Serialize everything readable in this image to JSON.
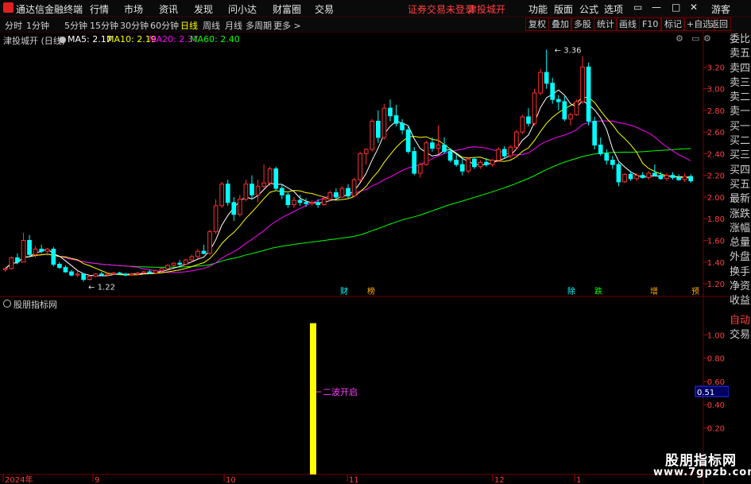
{
  "app": {
    "title": "通达信金融终端",
    "menu": [
      "行情",
      "市场",
      "资讯",
      "发现",
      "问小达",
      "财富圈",
      "交易"
    ],
    "notice": [
      "证券交易未登录",
      "津投城开"
    ],
    "right_menu": [
      "功能",
      "版面",
      "公式",
      "选项"
    ],
    "guest": "游客"
  },
  "toolbar": {
    "periods": [
      "分时",
      "1分钟",
      "5分钟",
      "15分钟",
      "30分钟",
      "60分钟",
      "日线",
      "周线",
      "月线",
      "多周期",
      "更多 >"
    ],
    "active": "日线",
    "right_buttons": [
      "复权",
      "叠加",
      "多股",
      "统计",
      "画线",
      "F10",
      "标记",
      "+自选",
      "返回"
    ]
  },
  "info": {
    "stock": "津投城开 (日线)",
    "ma5": "MA5: 2.17",
    "ma10": "MA10: 2.19",
    "ma20": "MA20: 2.37",
    "ma60": "MA60: 2.40",
    "colors": {
      "ma5": "#ffffff",
      "ma10": "#ffff00",
      "ma20": "#ff00ff",
      "ma60": "#00ff00"
    }
  },
  "side_panel": {
    "items": [
      "委比",
      "卖五",
      "卖四",
      "卖三",
      "卖二",
      "卖一",
      "买一",
      "买二",
      "买三",
      "买四",
      "买五",
      "最新",
      "涨跌",
      "涨幅",
      "总量",
      "外盘",
      "换手",
      "净资",
      "收益"
    ],
    "bottom": [
      "自动",
      "交易"
    ]
  },
  "indicator": {
    "title": "股朋指标网",
    "signal_label": "二波开启",
    "current_value": "0.51"
  },
  "watermark": {
    "line1": "股朋指标网",
    "line2": "www.7gpzb.com"
  },
  "chart_data": [
    {
      "type": "candlestick",
      "y_ticks": [
        "3.20",
        "3.00",
        "2.80",
        "2.60",
        "2.40",
        "2.20",
        "2.00",
        "1.80",
        "1.60",
        "1.40",
        "1.20"
      ],
      "ylim": [
        1.12,
        3.4
      ],
      "x_labels": [
        "2024年",
        "9",
        "10",
        "11",
        "12",
        "1"
      ],
      "annotations": {
        "high": "3.36",
        "low": "1.22"
      },
      "event_markers": [
        "财",
        "榜",
        "除",
        "跌",
        "增",
        "预"
      ],
      "candles": [
        [
          1.33,
          1.35,
          1.31,
          1.34
        ],
        [
          1.34,
          1.45,
          1.33,
          1.44
        ],
        [
          1.44,
          1.48,
          1.38,
          1.4
        ],
        [
          1.4,
          1.67,
          1.4,
          1.6
        ],
        [
          1.6,
          1.65,
          1.45,
          1.47
        ],
        [
          1.47,
          1.55,
          1.44,
          1.52
        ],
        [
          1.52,
          1.56,
          1.48,
          1.5
        ],
        [
          1.5,
          1.53,
          1.46,
          1.52
        ],
        [
          1.52,
          1.54,
          1.36,
          1.38
        ],
        [
          1.38,
          1.4,
          1.34,
          1.35
        ],
        [
          1.35,
          1.37,
          1.3,
          1.31
        ],
        [
          1.31,
          1.33,
          1.27,
          1.28
        ],
        [
          1.28,
          1.32,
          1.26,
          1.29
        ],
        [
          1.29,
          1.3,
          1.22,
          1.24
        ],
        [
          1.24,
          1.28,
          1.23,
          1.27
        ],
        [
          1.27,
          1.3,
          1.26,
          1.29
        ],
        [
          1.29,
          1.31,
          1.27,
          1.28
        ],
        [
          1.28,
          1.3,
          1.27,
          1.29
        ],
        [
          1.29,
          1.31,
          1.28,
          1.3
        ],
        [
          1.3,
          1.31,
          1.28,
          1.29
        ],
        [
          1.29,
          1.3,
          1.27,
          1.28
        ],
        [
          1.28,
          1.3,
          1.27,
          1.29
        ],
        [
          1.29,
          1.31,
          1.28,
          1.3
        ],
        [
          1.3,
          1.32,
          1.29,
          1.31
        ],
        [
          1.31,
          1.33,
          1.29,
          1.3
        ],
        [
          1.3,
          1.33,
          1.29,
          1.32
        ],
        [
          1.32,
          1.35,
          1.31,
          1.34
        ],
        [
          1.34,
          1.38,
          1.33,
          1.37
        ],
        [
          1.37,
          1.4,
          1.35,
          1.39
        ],
        [
          1.39,
          1.42,
          1.36,
          1.38
        ],
        [
          1.38,
          1.43,
          1.37,
          1.42
        ],
        [
          1.42,
          1.47,
          1.4,
          1.45
        ],
        [
          1.45,
          1.52,
          1.43,
          1.5
        ],
        [
          1.5,
          1.56,
          1.47,
          1.48
        ],
        [
          1.48,
          1.7,
          1.47,
          1.68
        ],
        [
          1.68,
          1.98,
          1.66,
          1.92
        ],
        [
          1.92,
          2.14,
          1.9,
          2.12
        ],
        [
          2.12,
          2.16,
          1.92,
          1.95
        ],
        [
          1.95,
          2.0,
          1.78,
          1.84
        ],
        [
          1.84,
          2.02,
          1.82,
          1.98
        ],
        [
          1.98,
          2.16,
          1.96,
          2.12
        ],
        [
          2.12,
          2.2,
          1.98,
          2.02
        ],
        [
          2.02,
          2.16,
          1.95,
          2.1
        ],
        [
          2.1,
          2.3,
          2.08,
          2.13
        ],
        [
          2.13,
          2.28,
          2.1,
          2.26
        ],
        [
          2.26,
          2.28,
          2.06,
          2.08
        ],
        [
          2.08,
          2.12,
          1.98,
          2.02
        ],
        [
          2.02,
          2.04,
          1.9,
          1.93
        ],
        [
          1.93,
          2.0,
          1.9,
          1.97
        ],
        [
          1.97,
          2.02,
          1.92,
          1.95
        ],
        [
          1.95,
          1.99,
          1.91,
          1.94
        ],
        [
          1.94,
          1.97,
          1.92,
          1.95
        ],
        [
          1.95,
          1.98,
          1.9,
          1.93
        ],
        [
          1.93,
          2.0,
          1.92,
          1.98
        ],
        [
          1.98,
          2.06,
          1.96,
          2.04
        ],
        [
          2.04,
          2.08,
          1.98,
          2.0
        ],
        [
          2.0,
          2.1,
          1.99,
          2.08
        ],
        [
          2.08,
          2.12,
          1.99,
          2.01
        ],
        [
          2.01,
          2.18,
          2.0,
          2.16
        ],
        [
          2.16,
          2.42,
          2.14,
          2.4
        ],
        [
          2.4,
          2.45,
          2.3,
          2.44
        ],
        [
          2.44,
          2.72,
          2.42,
          2.7
        ],
        [
          2.7,
          2.8,
          2.5,
          2.55
        ],
        [
          2.55,
          2.86,
          2.53,
          2.82
        ],
        [
          2.82,
          2.9,
          2.7,
          2.75
        ],
        [
          2.75,
          2.85,
          2.65,
          2.68
        ],
        [
          2.68,
          2.72,
          2.58,
          2.62
        ],
        [
          2.62,
          2.65,
          2.4,
          2.42
        ],
        [
          2.42,
          2.46,
          2.2,
          2.22
        ],
        [
          2.22,
          2.32,
          2.18,
          2.3
        ],
        [
          2.3,
          2.52,
          2.29,
          2.5
        ],
        [
          2.5,
          2.55,
          2.42,
          2.45
        ],
        [
          2.45,
          2.66,
          2.4,
          2.48
        ],
        [
          2.48,
          2.55,
          2.4,
          2.42
        ],
        [
          2.42,
          2.45,
          2.32,
          2.34
        ],
        [
          2.34,
          2.4,
          2.28,
          2.3
        ],
        [
          2.3,
          2.36,
          2.2,
          2.24
        ],
        [
          2.24,
          2.37,
          2.22,
          2.35
        ],
        [
          2.35,
          2.37,
          2.26,
          2.28
        ],
        [
          2.28,
          2.34,
          2.26,
          2.32
        ],
        [
          2.32,
          2.36,
          2.28,
          2.3
        ],
        [
          2.3,
          2.35,
          2.28,
          2.34
        ],
        [
          2.34,
          2.46,
          2.32,
          2.44
        ],
        [
          2.44,
          2.47,
          2.36,
          2.38
        ],
        [
          2.38,
          2.48,
          2.36,
          2.46
        ],
        [
          2.46,
          2.62,
          2.44,
          2.6
        ],
        [
          2.6,
          2.76,
          2.58,
          2.74
        ],
        [
          2.74,
          2.82,
          2.65,
          2.68
        ],
        [
          2.68,
          3.0,
          2.66,
          2.96
        ],
        [
          2.96,
          3.18,
          2.94,
          3.15
        ],
        [
          3.15,
          3.36,
          3.0,
          3.05
        ],
        [
          3.05,
          3.1,
          2.86,
          2.9
        ],
        [
          2.9,
          2.94,
          2.8,
          2.88
        ],
        [
          2.88,
          2.93,
          2.7,
          2.72
        ],
        [
          2.72,
          2.78,
          2.66,
          2.76
        ],
        [
          2.76,
          2.9,
          2.75,
          2.88
        ],
        [
          2.88,
          3.3,
          2.86,
          3.2
        ],
        [
          3.2,
          3.24,
          2.66,
          2.7
        ],
        [
          2.7,
          2.74,
          2.44,
          2.48
        ],
        [
          2.48,
          2.55,
          2.38,
          2.4
        ],
        [
          2.4,
          2.44,
          2.3,
          2.34
        ],
        [
          2.34,
          2.38,
          2.26,
          2.3
        ],
        [
          2.3,
          2.32,
          2.1,
          2.14
        ],
        [
          2.14,
          2.22,
          2.13,
          2.21
        ],
        [
          2.21,
          2.24,
          2.15,
          2.17
        ],
        [
          2.17,
          2.22,
          2.15,
          2.2
        ],
        [
          2.2,
          2.23,
          2.17,
          2.18
        ],
        [
          2.18,
          2.24,
          2.16,
          2.22
        ],
        [
          2.22,
          2.3,
          2.19,
          2.2
        ],
        [
          2.2,
          2.23,
          2.16,
          2.17
        ],
        [
          2.17,
          2.22,
          2.15,
          2.2
        ],
        [
          2.2,
          2.23,
          2.16,
          2.18
        ],
        [
          2.18,
          2.21,
          2.15,
          2.16
        ],
        [
          2.16,
          2.22,
          2.14,
          2.19
        ],
        [
          2.19,
          2.21,
          2.13,
          2.15
        ]
      ]
    },
    {
      "type": "bar",
      "title": "股朋指标网",
      "y_ticks": [
        "1.00",
        "0.80",
        "0.60",
        "0.40",
        "0.20"
      ],
      "ylim": [
        -0.2,
        1.2
      ],
      "bar_index": 76,
      "bar_value": 1.1,
      "signal_value": 0.51
    }
  ]
}
